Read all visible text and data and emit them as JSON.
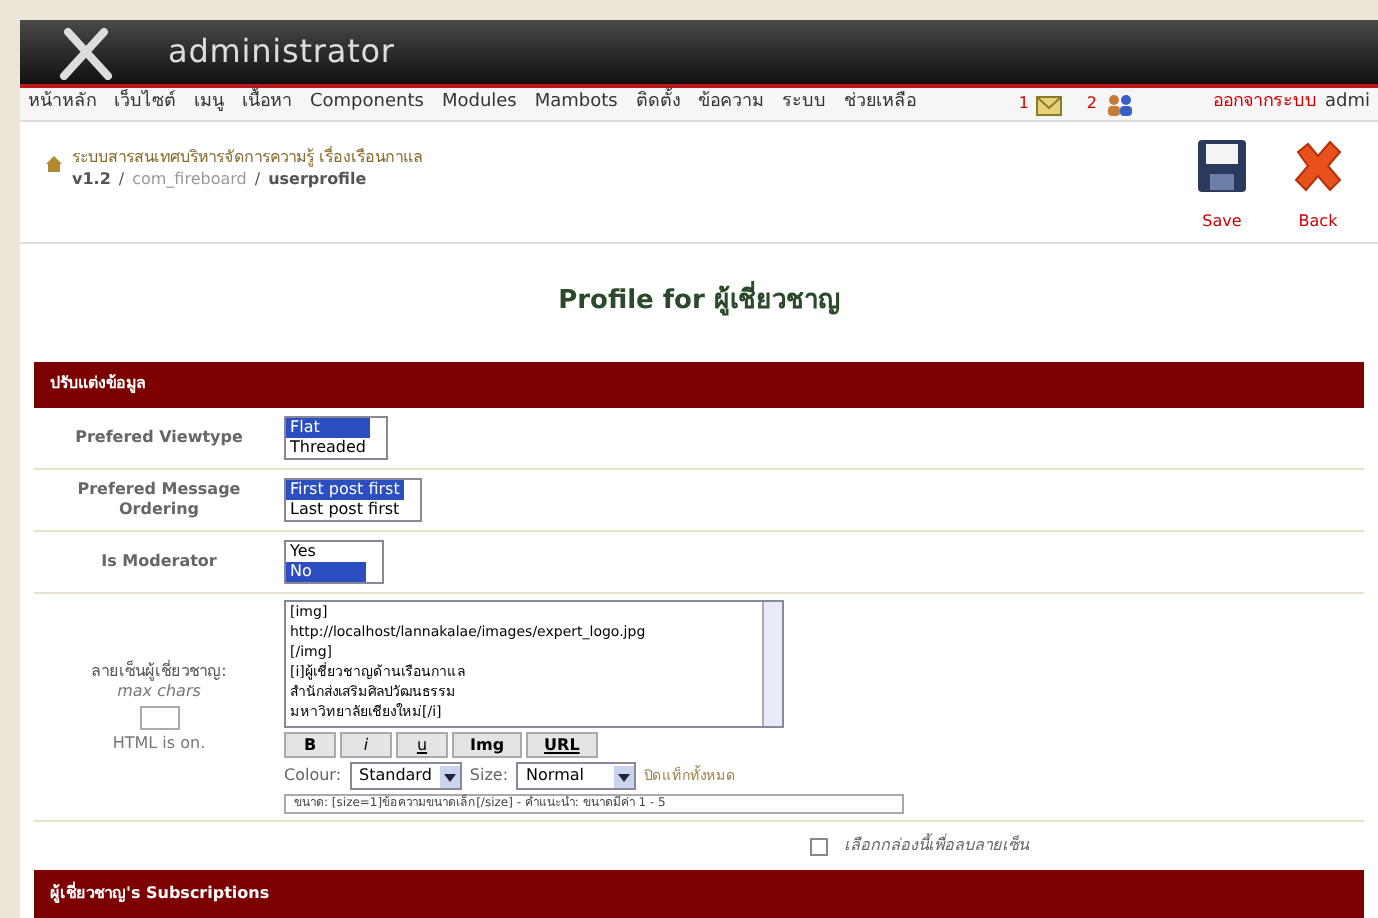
{
  "header": {
    "title": "administrator"
  },
  "menu": {
    "items": [
      "หน้าหลัก",
      "เว็บไซต์",
      "เมนู",
      "เนื้อหา",
      "Components",
      "Modules",
      "Mambots",
      "ติดตั้ง",
      "ข้อความ",
      "ระบบ",
      "ช่วยเหลือ"
    ],
    "messages_count": "1",
    "users_count": "2",
    "logout": "ออกจากระบบ",
    "user": "admi"
  },
  "breadcrumb": {
    "site": "ระบบสารสนเทศบริหารจัดการความรู้ เรื่องเรือนกาแล",
    "version": "v1.2",
    "separator": "/",
    "component": "com_fireboard",
    "page": "userprofile"
  },
  "toolbar": [
    {
      "kind": "save",
      "label": "Save"
    },
    {
      "kind": "back",
      "label": "Back"
    }
  ],
  "page_title": "Profile for ผู้เชี่ยวชาญ",
  "section": "ปรับแต่งข้อมูล",
  "fields": [
    {
      "label": "Prefered Viewtype",
      "options": [
        {
          "label": "Flat",
          "selected": true
        },
        {
          "label": "Threaded",
          "selected": false
        }
      ]
    },
    {
      "label": "Prefered Message Ordering",
      "options": [
        {
          "label": "First post first",
          "selected": true
        },
        {
          "label": "Last post first",
          "selected": false
        }
      ]
    },
    {
      "label": "Is Moderator",
      "options": [
        {
          "label": "Yes",
          "selected": false
        },
        {
          "label": "No",
          "selected": true
        }
      ]
    }
  ],
  "signature": {
    "label": "ลายเซ็นผู้เชี่ยวชาญ:",
    "max_chars": "max chars",
    "html_note": "HTML is on.",
    "value": "[img]\nhttp://localhost/lannakalae/images/expert_logo.jpg\n[/img]\n[i]ผู้เชี่ยวชาญด้านเรือนกาแล\nสำนักส่งเสริมศิลปวัฒนธรรม\nมหาวิทยาลัยเชียงใหม่[/i]",
    "format_buttons": [
      "B",
      "i",
      "u",
      "Img",
      "URL"
    ],
    "colour_label": "Colour:",
    "colour_value": "Standard",
    "size_label": "Size:",
    "size_value": "Normal",
    "close_tags": "ปิดแท็กทั้งหมด",
    "help": "ขนาด: [size=1]ข้อความขนาดเล็ก[/size] - คำแนะนำ: ขนาดมีค่า 1 - 5",
    "delete": {
      "label": "เลือกกล่องนี้เพื่อลบลายเซ็น",
      "checked": false
    }
  },
  "subscriptions_section": "ผู้เชี่ยวชาญ's Subscriptions"
}
